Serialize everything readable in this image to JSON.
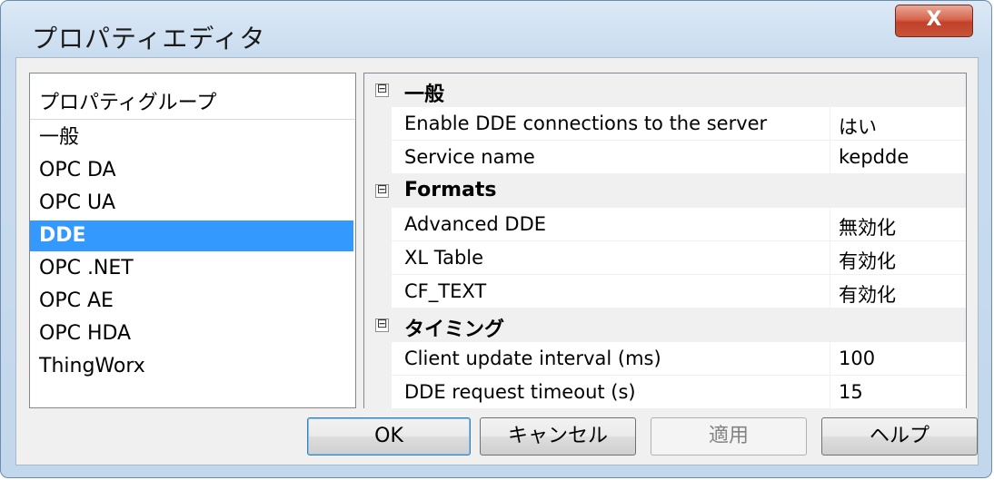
{
  "window": {
    "title": "プロパティエディタ",
    "close_label": "X"
  },
  "groups": {
    "header": "プロパティグループ",
    "items": [
      {
        "label": "一般"
      },
      {
        "label": "OPC DA"
      },
      {
        "label": "OPC UA"
      },
      {
        "label": "DDE",
        "selected": true
      },
      {
        "label": "OPC .NET"
      },
      {
        "label": "OPC AE"
      },
      {
        "label": "OPC HDA"
      },
      {
        "label": "ThingWorx"
      }
    ]
  },
  "grid": {
    "categories": [
      {
        "toggle": "⊟",
        "label": "一般",
        "props": [
          {
            "name": "Enable DDE connections to the server",
            "value": "はい"
          },
          {
            "name": "Service name",
            "value": "kepdde"
          }
        ]
      },
      {
        "toggle": "⊟",
        "label": "Formats",
        "props": [
          {
            "name": "Advanced DDE",
            "value": "無効化"
          },
          {
            "name": "XL Table",
            "value": "有効化"
          },
          {
            "name": "CF_TEXT",
            "value": "有効化"
          }
        ]
      },
      {
        "toggle": "⊟",
        "label": "タイミング",
        "props": [
          {
            "name": "Client update interval (ms)",
            "value": "100"
          },
          {
            "name": "DDE request timeout (s)",
            "value": "15"
          }
        ]
      }
    ]
  },
  "buttons": {
    "ok": "OK",
    "cancel": "キャンセル",
    "apply": "適用",
    "help": "ヘルプ"
  }
}
